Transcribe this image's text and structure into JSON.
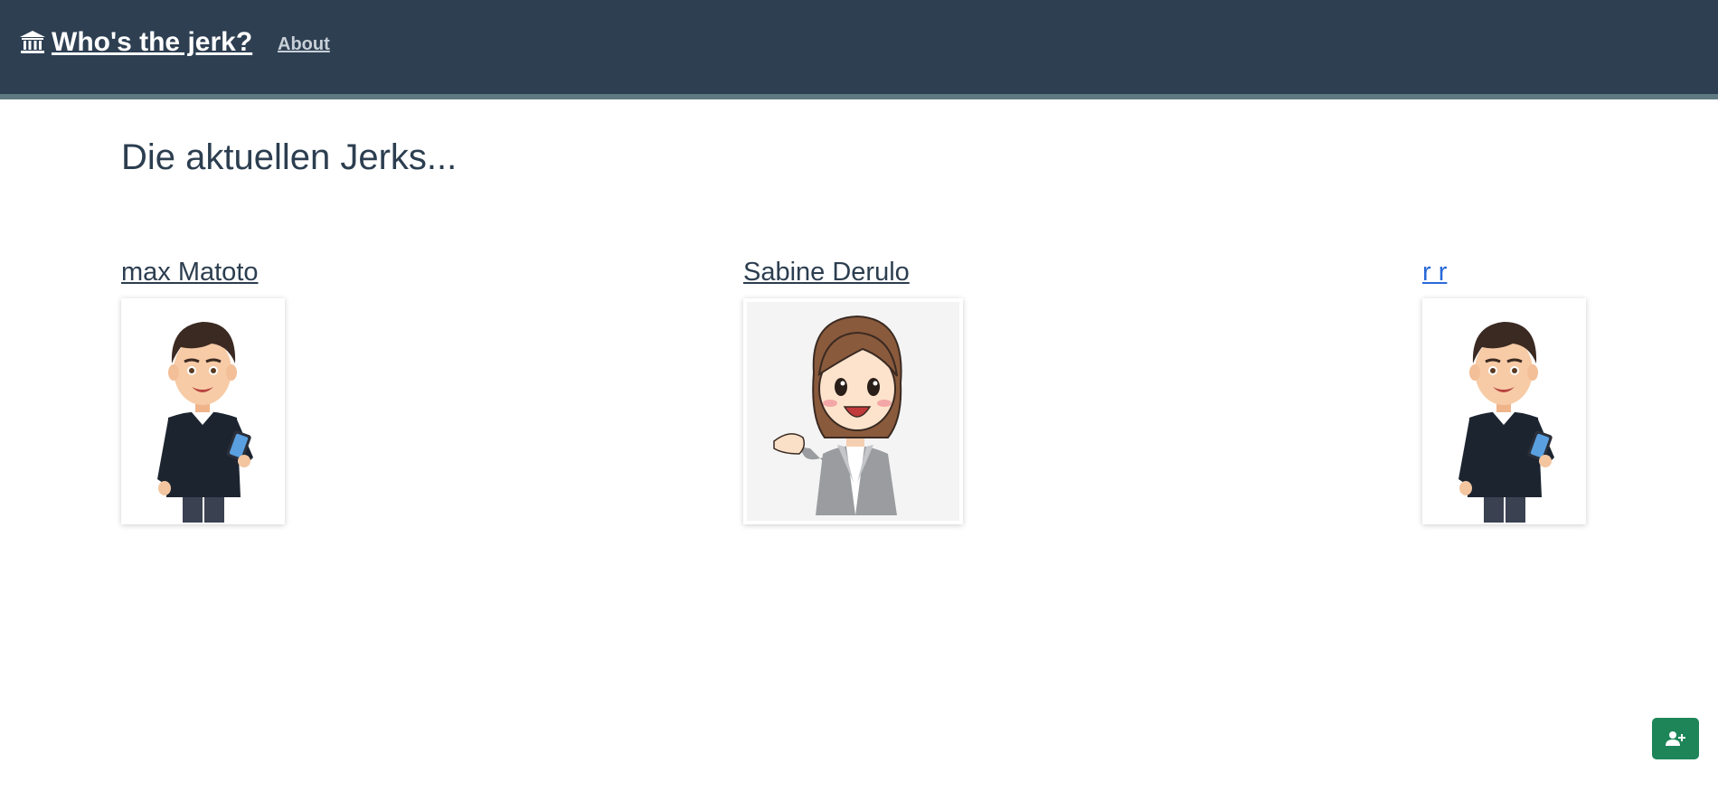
{
  "navbar": {
    "brand_label": "Who's the jerk?",
    "brand_icon": "bank-icon",
    "about_label": "About",
    "background": "#2e3f52",
    "accent_border": "#5e7a80"
  },
  "main": {
    "title": "Die aktuellen Jerks..."
  },
  "jerks": [
    {
      "name": "max Matoto",
      "avatar": "man-with-phone-avatar"
    },
    {
      "name": "Sabine Derulo",
      "avatar": "woman-presenting-avatar"
    },
    {
      "name": "r r",
      "avatar": "man-with-phone-avatar"
    }
  ],
  "add_button": {
    "icon": "user-plus-icon",
    "color": "#1e8558"
  }
}
